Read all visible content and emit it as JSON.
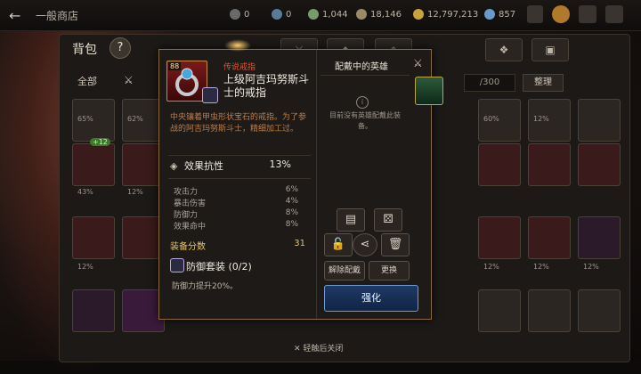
{
  "topbar": {
    "title": "一般商店",
    "currencies": [
      "0",
      "0",
      "1,044",
      "18,146",
      "12,797,213",
      "857"
    ]
  },
  "bag": {
    "title": "背包",
    "help": "?",
    "filter_all": "全部",
    "capacity": "/300",
    "sort": "整理",
    "slot_labels": [
      "65%",
      "62%",
      "43%",
      "12%",
      "12%",
      "60%",
      "12%",
      "12%",
      "12%",
      "12%"
    ],
    "plus_badge": "+12"
  },
  "popup": {
    "level": "88",
    "rarity": "传说戒指",
    "item_name": "上级阿吉玛努斯斗士的戒指",
    "description": "中央镶着甲虫形状宝石的戒指。为了参战的阿吉玛努斯斗士，精细加工过。",
    "main_stat": {
      "name": "效果抗性",
      "value": "13%"
    },
    "sub_stats": [
      {
        "name": "攻击力",
        "value": "6%"
      },
      {
        "name": "暴击伤害",
        "value": "4%"
      },
      {
        "name": "防御力",
        "value": "8%"
      },
      {
        "name": "效果命中",
        "value": "8%"
      }
    ],
    "score_label": "装备分数",
    "score_value": "31",
    "set_name": "防御套装",
    "set_count": "(0/2)",
    "set_effect": "防御力提升20%。",
    "heroes_title": "配戴中的英雄",
    "no_hero": "目前没有英雄配戴此装备。",
    "unequip": "解除配戴",
    "change": "更换",
    "enhance": "强化"
  },
  "footer": {
    "hint": "✕ 轻触后关闭"
  },
  "colors": {
    "accent_gold": "#8a6a3c",
    "legend_red": "#e2542e",
    "enhance_blue": "#1e3a64"
  }
}
